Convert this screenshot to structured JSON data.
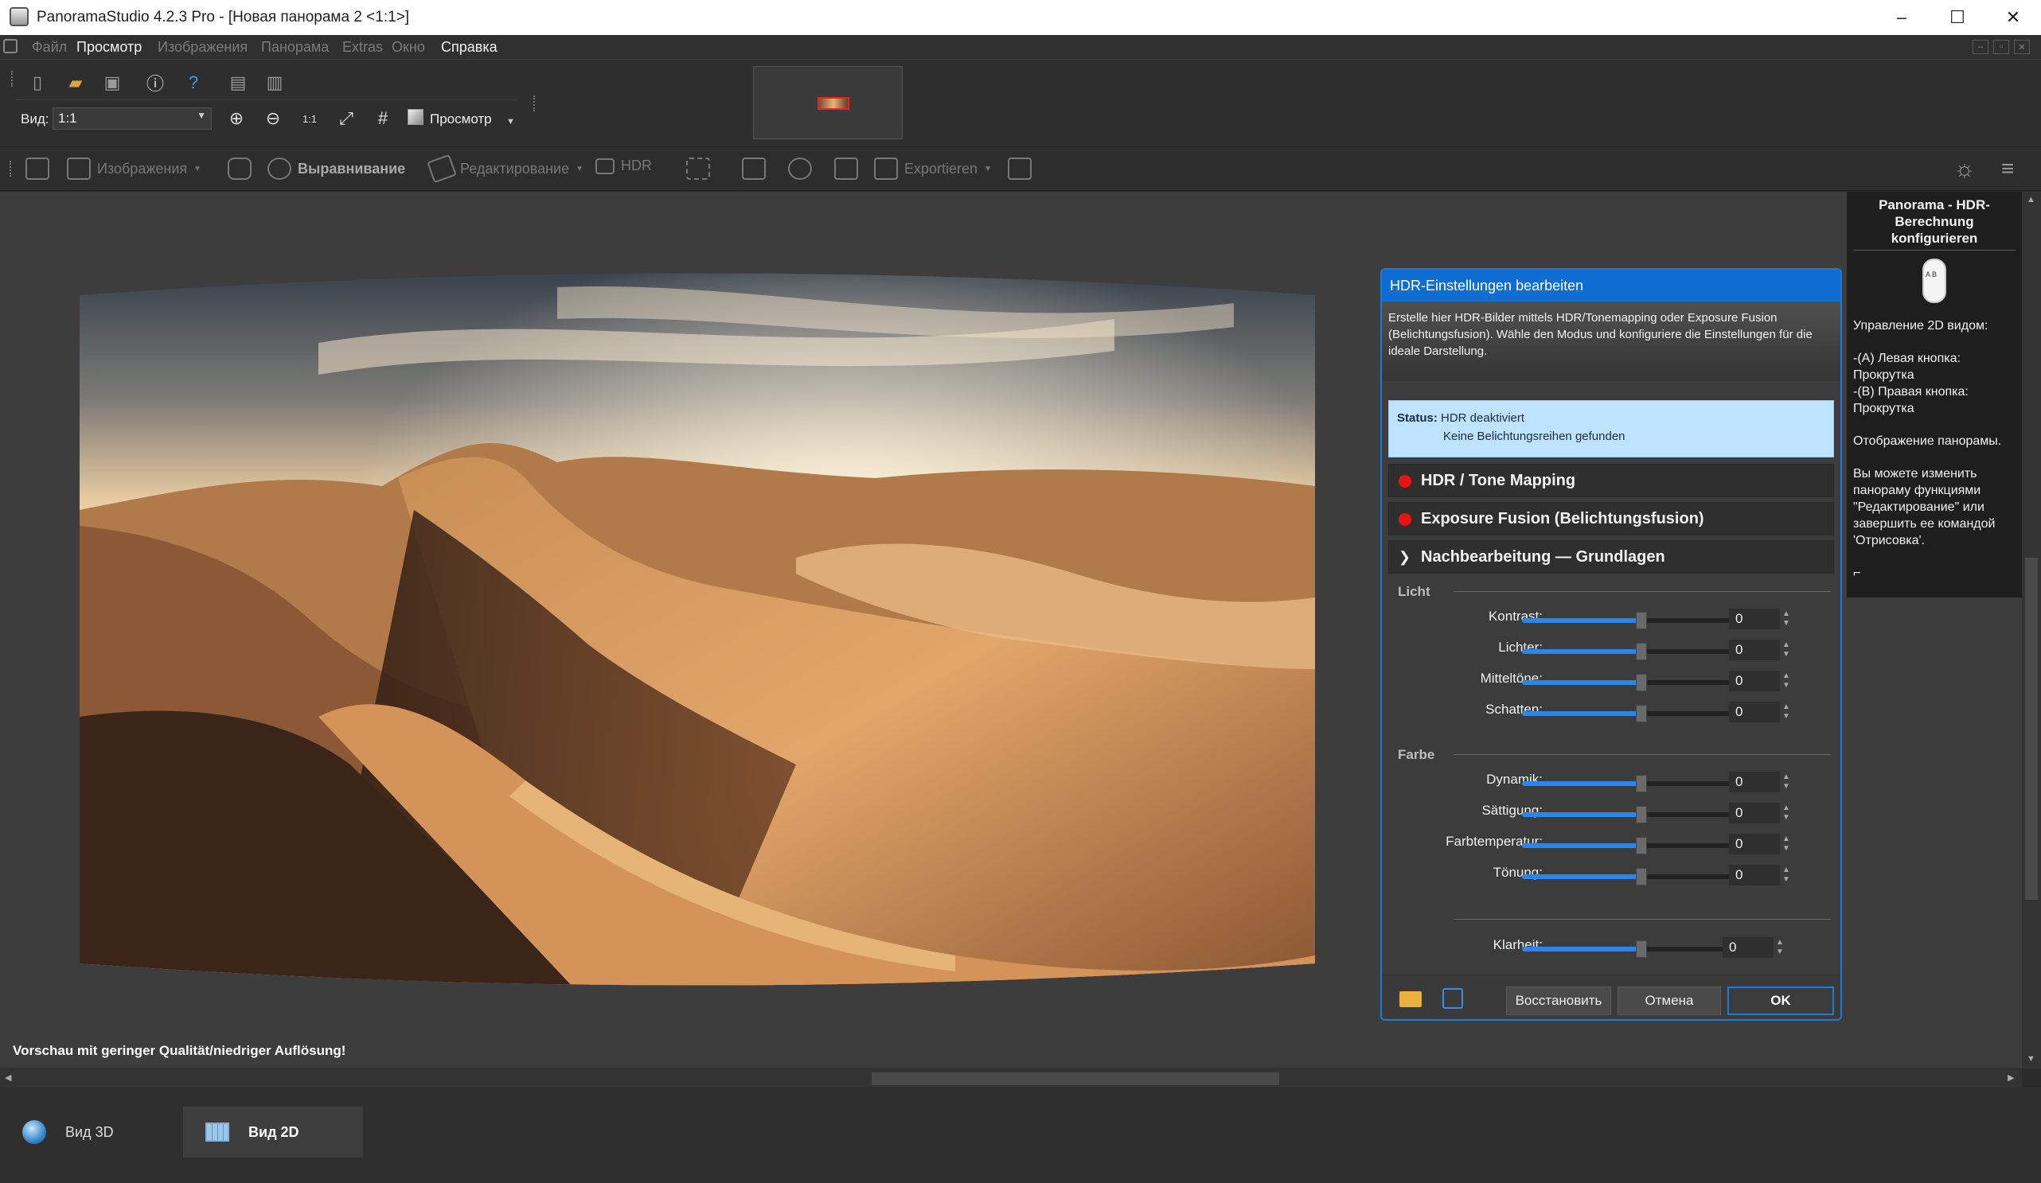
{
  "window": {
    "title": "PanoramaStudio 4.2.3 Pro - [Новая панорама 2 <1:1>]",
    "minimize": "–",
    "maximize": "☐",
    "close": "✕"
  },
  "menu": {
    "items": [
      {
        "label": "Файл",
        "enabled": false
      },
      {
        "label": "Просмотр",
        "enabled": true
      },
      {
        "label": "Изображения",
        "enabled": false
      },
      {
        "label": "Панорама",
        "enabled": false
      },
      {
        "label": "Extras",
        "enabled": false
      },
      {
        "label": "Окно",
        "enabled": false
      },
      {
        "label": "Справка",
        "enabled": true
      }
    ]
  },
  "toolbar": {
    "view_label": "Вид:",
    "zoom_value": "1:1",
    "preview_label": "Просмотр",
    "icons": [
      "new-icon",
      "open-icon",
      "save-icon",
      "info-icon",
      "help-icon",
      "export-left-icon",
      "export-right-icon"
    ],
    "zoom_icons": [
      "zoom-in-icon",
      "zoom-out-icon",
      "zoom-1to1-icon",
      "fit-icon",
      "grid-icon"
    ]
  },
  "workflow_toolbar": {
    "images_label": "Изображения",
    "align_label": "Выравнивание",
    "edit_label": "Редактирование",
    "hdr_label": "HDR",
    "export_label": "Exportieren"
  },
  "workspace": {
    "preview_note": "Vorschau mit geringer Qualität/niedriger Auflösung!"
  },
  "help": {
    "title": "Panorama - HDR-Berechnung konfigurieren",
    "para1": "Управление 2D видом:",
    "para2a": "-(A) Левая кнопка: Прокрутка",
    "para2b": "-(B) Правая кнопка: Прокрутка",
    "para3": "Отображение панорамы.",
    "para4": "Вы можете изменить панораму функциями \"Редактирование\" или завершить ее командой 'Отрисовка'."
  },
  "dialog": {
    "title": "HDR-Einstellungen bearbeiten",
    "description": "Erstelle hier HDR-Bilder mittels HDR/Tonemapping oder Exposure Fusion (Belichtungsfusion). Wähle den Modus und konfiguriere die Einstellungen für die ideale Darstellung.",
    "status_label": "Status:",
    "status_line1": "HDR deaktiviert",
    "status_line2": "Keine Belichtungsreihen gefunden",
    "section_hdr": "HDR / Tone Mapping",
    "section_fusion": "Exposure Fusion (Belichtungsfusion)",
    "section_post": "Nachbearbeitung — Grundlagen",
    "group_light": "Licht",
    "group_color": "Farbe",
    "light": [
      {
        "label": "Kontrast:",
        "value": "0",
        "fraction": 0.5
      },
      {
        "label": "Lichter:",
        "value": "0",
        "fraction": 0.5
      },
      {
        "label": "Mitteltöne:",
        "value": "0",
        "fraction": 0.5
      },
      {
        "label": "Schatten:",
        "value": "0",
        "fraction": 0.5
      }
    ],
    "color": [
      {
        "label": "Dynamik:",
        "value": "0",
        "fraction": 0.5
      },
      {
        "label": "Sättigung:",
        "value": "0",
        "fraction": 0.5
      },
      {
        "label": "Farbtemperatur:",
        "value": "0",
        "fraction": 0.5
      },
      {
        "label": "Tönung:",
        "value": "0",
        "fraction": 0.5
      }
    ],
    "clarity": {
      "label": "Klarheit:",
      "value": "0",
      "fraction": 0.5
    },
    "btn_restore": "Восстановить",
    "btn_cancel": "Отмена",
    "btn_ok": "OK"
  },
  "bottom_tabs": {
    "view3d": "Вид 3D",
    "view2d": "Вид 2D"
  },
  "colors": {
    "accent": "#0f6cd1",
    "status_bg": "#bde3ff",
    "indicator_red": "#e8150f"
  }
}
